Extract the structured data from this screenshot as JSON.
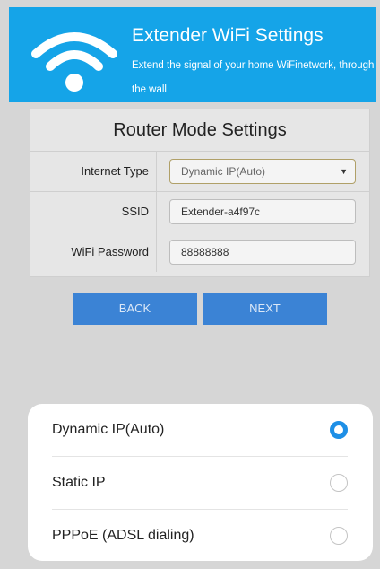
{
  "header": {
    "title": "Extender WiFi Settings",
    "subtitle": "Extend the signal of your home WiFinetwork, through the wall",
    "icon": "wifi-icon",
    "color": "#15a4e8"
  },
  "form": {
    "title": "Router Mode Settings",
    "internet_type": {
      "label": "Internet Type",
      "value": "Dynamic IP(Auto)"
    },
    "ssid": {
      "label": "SSID",
      "value": "Extender-a4f97c"
    },
    "password": {
      "label": "WiFi Password",
      "value": "88888888"
    }
  },
  "buttons": {
    "back": "BACK",
    "next": "NEXT",
    "color": "#3b83d5"
  },
  "picker": {
    "options": [
      {
        "label": "Dynamic IP(Auto)",
        "selected": true
      },
      {
        "label": "Static IP",
        "selected": false
      },
      {
        "label": "PPPoE (ADSL dialing)",
        "selected": false
      }
    ],
    "accent": "#1e8fe6"
  }
}
